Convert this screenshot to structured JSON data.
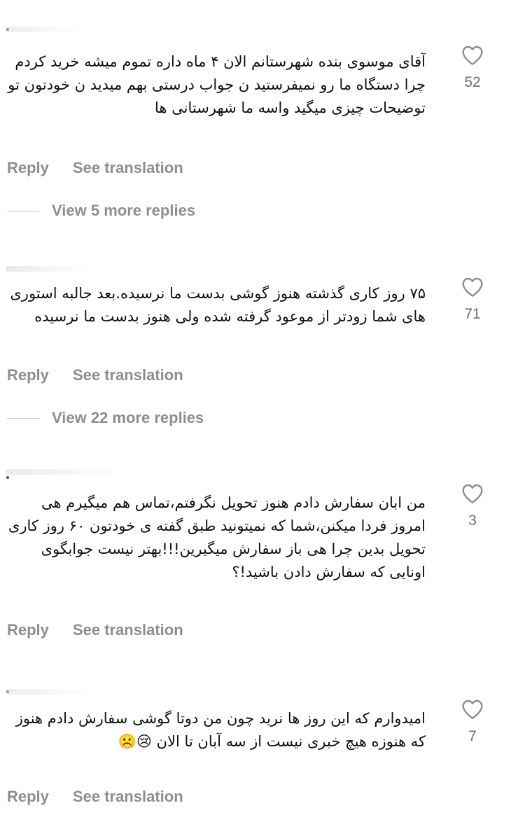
{
  "comments": [
    {
      "text": "آقای موسوی بنده شهرستانم الان ۴ ماه داره تموم میشه خرید کردم چرا دستگاه ما رو نمیفرستید ن جواب درستی بهم میدید ن خودتون تو توضیحات چیزی میگید واسه ما شهرستانی ها",
      "likes": "52",
      "reply_label": "Reply",
      "translate_label": "See translation",
      "view_replies": "View 5 more replies"
    },
    {
      "text": "۷۵ روز کاری گذشته هنوز گوشی بدست ما نرسیده.بعد جالبه استوری های شما زودتر از موعود گرفته شده ولی هنوز بدست ما نرسیده",
      "likes": "71",
      "reply_label": "Reply",
      "translate_label": "See translation",
      "view_replies": "View 22 more replies"
    },
    {
      "text": "من ابان سفارش دادم هنوز تحویل نگرفتم،تماس هم میگیرم هی امروز فردا میکنن،شما که نمیتونید طبق گفته ی خودتون ۶۰ روز کاری تحویل بدین چرا هی باز سفارش میگیرین!!!بهتر نیست جوابگوی اونایی که سفارش دادن باشید!؟",
      "likes": "3",
      "reply_label": "Reply",
      "translate_label": "See translation"
    },
    {
      "text": "امیدوارم که این روز ها نرید چون من دوتا گوشی سفارش دادم هنوز که هنوزه هیچ خبری نیست از سه آبان تا الان 😢☹️",
      "likes": "7",
      "reply_label": "Reply",
      "translate_label": "See translation"
    }
  ],
  "icons": {
    "like": "heart-outline-icon"
  },
  "colors": {
    "text": "#111111",
    "secondary": "#8e8e8e",
    "count": "#6e6e6e",
    "background": "#ffffff"
  }
}
